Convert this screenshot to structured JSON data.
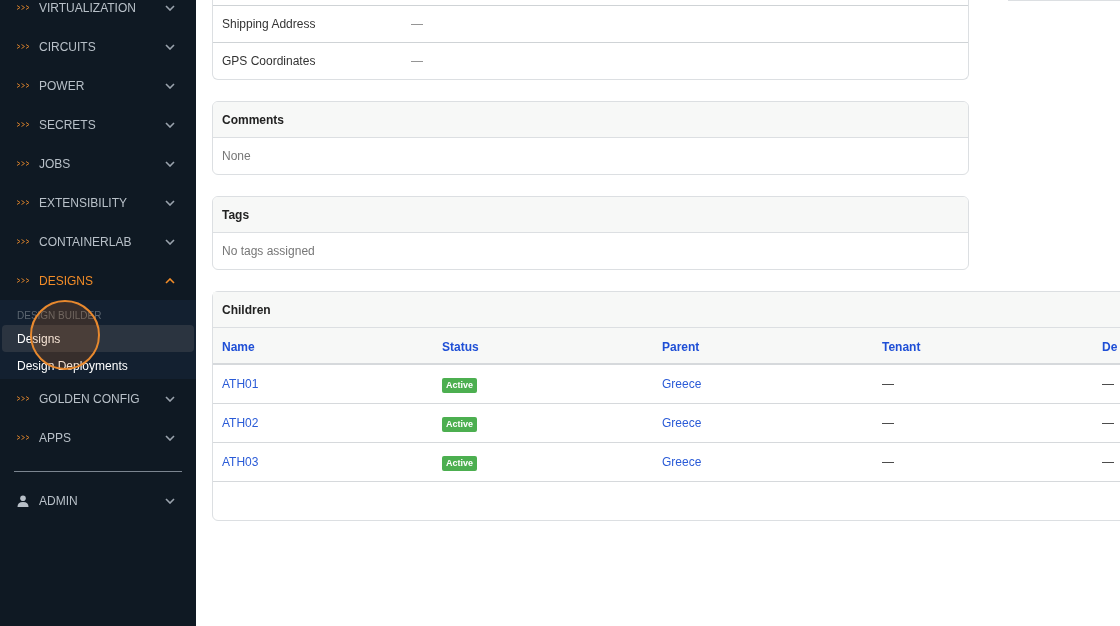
{
  "sidebar": {
    "items": [
      {
        "kind": "section",
        "label": "VIRTUALIZATION",
        "expanded": false
      },
      {
        "kind": "section",
        "label": "CIRCUITS",
        "expanded": false
      },
      {
        "kind": "section",
        "label": "POWER",
        "expanded": false
      },
      {
        "kind": "section",
        "label": "SECRETS",
        "expanded": false
      },
      {
        "kind": "section",
        "label": "JOBS",
        "expanded": false
      },
      {
        "kind": "section",
        "label": "EXTENSIBILITY",
        "expanded": false
      },
      {
        "kind": "section",
        "label": "CONTAINERLAB",
        "expanded": false
      },
      {
        "kind": "section",
        "label": "DESIGNS",
        "expanded": true
      },
      {
        "kind": "group",
        "label": "DESIGN BUILDER"
      },
      {
        "kind": "link",
        "label": "Designs",
        "selected": true
      },
      {
        "kind": "link",
        "label": "Design Deployments",
        "selected": false
      },
      {
        "kind": "section",
        "label": "GOLDEN CONFIG",
        "expanded": false
      },
      {
        "kind": "section",
        "label": "APPS",
        "expanded": false
      },
      {
        "kind": "divider"
      },
      {
        "kind": "user",
        "label": "ADMIN",
        "expanded": false
      }
    ]
  },
  "details": {
    "rows": [
      {
        "label": "Shipping Address",
        "value": "—"
      },
      {
        "label": "GPS Coordinates",
        "value": "—"
      }
    ]
  },
  "comments": {
    "title": "Comments",
    "text": "None"
  },
  "tags": {
    "title": "Tags",
    "text": "No tags assigned"
  },
  "children": {
    "title": "Children",
    "columns": [
      "Name",
      "Status",
      "Parent",
      "Tenant",
      "De"
    ],
    "rows": [
      {
        "name": "ATH01",
        "status": "Active",
        "color": "#4caf50",
        "parent": "Greece",
        "tenant": "—",
        "column_5": "—"
      },
      {
        "name": "ATH02",
        "status": "Active",
        "color": "#4caf50",
        "parent": "Greece",
        "tenant": "—",
        "column_5": "—"
      },
      {
        "name": "ATH03",
        "status": "Active",
        "color": "#4caf50",
        "parent": "Greece",
        "tenant": "—",
        "column_5": "—"
      }
    ]
  }
}
